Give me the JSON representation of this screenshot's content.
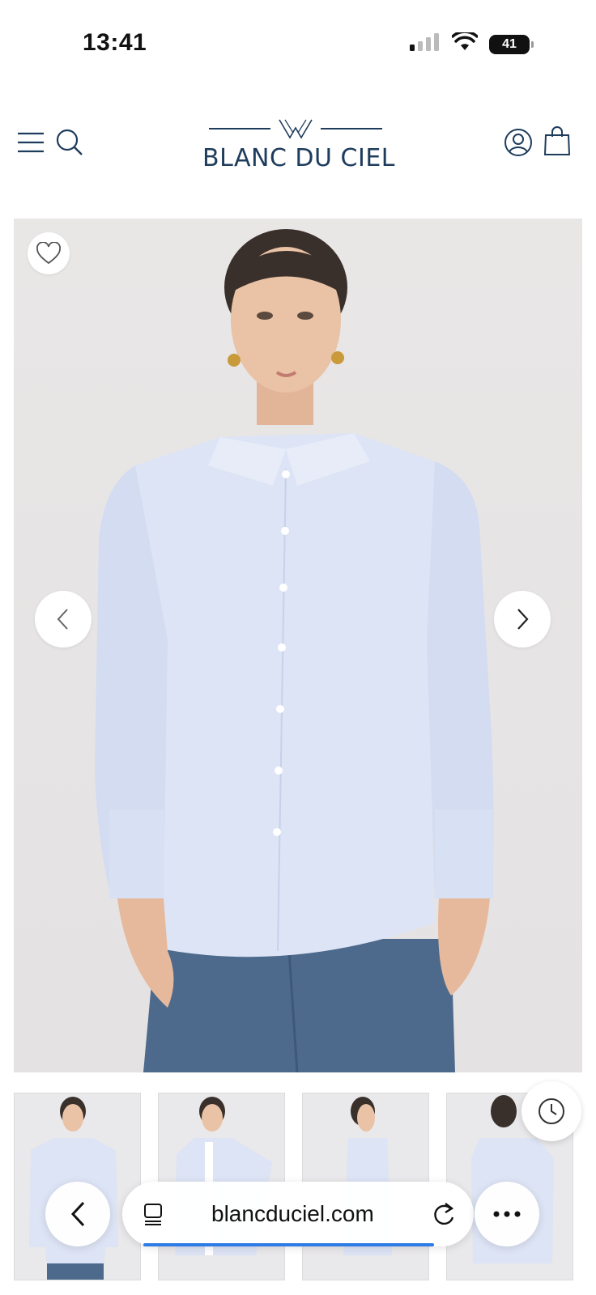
{
  "status_bar": {
    "time": "13:41",
    "battery": "41",
    "icons": [
      "cellular-signal-icon",
      "wifi-icon",
      "battery-icon"
    ]
  },
  "header": {
    "brand": "BLANC DU CIEL",
    "icons": [
      "menu-icon",
      "search-icon",
      "account-icon",
      "shopping-bag-icon"
    ],
    "brand_color": "#1e3c5c"
  },
  "product_gallery": {
    "icons": [
      "heart-icon",
      "chevron-left-icon",
      "chevron-right-icon"
    ],
    "thumbnail_count": 4
  },
  "browser": {
    "url": "blancduciel.com",
    "icons": [
      "back-icon",
      "tabs-icon",
      "reload-icon",
      "more-icon",
      "history-icon"
    ],
    "load_progress": 0.94,
    "accent": "#2d7be5"
  }
}
